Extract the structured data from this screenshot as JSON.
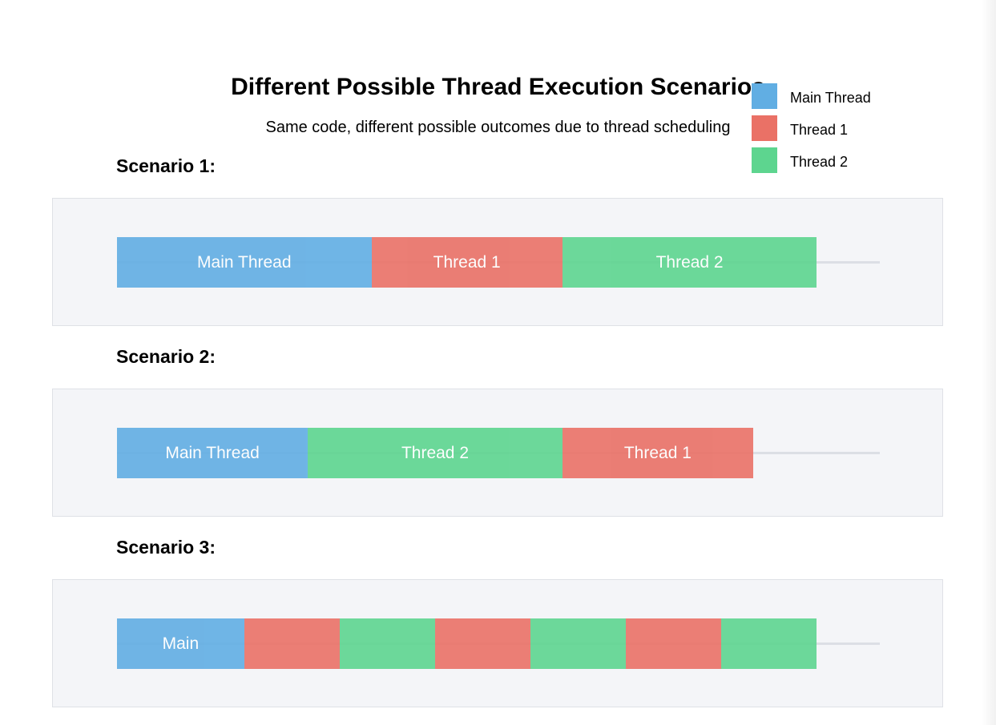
{
  "title": "Different Possible Thread Execution Scenarios",
  "subtitle": "Same code, different possible outcomes due to thread scheduling",
  "colors": {
    "main": "#61aee3",
    "t1": "#ea7166",
    "t2": "#5dd58f"
  },
  "legend": [
    {
      "label": "Main Thread",
      "color": "#61aee3"
    },
    {
      "label": "Thread 1",
      "color": "#ea7166"
    },
    {
      "label": "Thread 2",
      "color": "#5dd58f"
    }
  ],
  "scenarios": [
    {
      "label": "Scenario 1:",
      "segments": [
        {
          "thread": "main",
          "text": "Main Thread",
          "duration": 8
        },
        {
          "thread": "t1",
          "text": "Thread 1",
          "duration": 6
        },
        {
          "thread": "t2",
          "text": "Thread 2",
          "duration": 8
        }
      ]
    },
    {
      "label": "Scenario 2:",
      "segments": [
        {
          "thread": "main",
          "text": "Main Thread",
          "duration": 6
        },
        {
          "thread": "t2",
          "text": "Thread 2",
          "duration": 8
        },
        {
          "thread": "t1",
          "text": "Thread 1",
          "duration": 6
        }
      ]
    },
    {
      "label": "Scenario 3:",
      "segments": [
        {
          "thread": "main",
          "text": "Main",
          "duration": 4
        },
        {
          "thread": "t1",
          "text": "",
          "duration": 3
        },
        {
          "thread": "t2",
          "text": "",
          "duration": 3
        },
        {
          "thread": "t1",
          "text": "",
          "duration": 3
        },
        {
          "thread": "t2",
          "text": "",
          "duration": 3
        },
        {
          "thread": "t1",
          "text": "",
          "duration": 3
        },
        {
          "thread": "t2",
          "text": "",
          "duration": 3
        }
      ]
    }
  ]
}
